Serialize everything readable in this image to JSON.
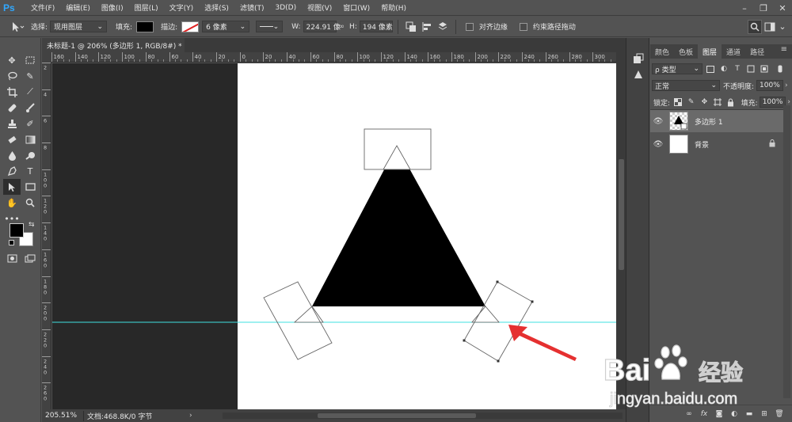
{
  "app": {
    "logo": "Ps"
  },
  "menu": [
    "文件(F)",
    "编辑(E)",
    "图像(I)",
    "图层(L)",
    "文字(Y)",
    "选择(S)",
    "滤镜(T)",
    "3D(D)",
    "视图(V)",
    "窗口(W)",
    "帮助(H)"
  ],
  "options": {
    "select_label": "选择:",
    "select_value": "现用图层",
    "fill_label": "填充:",
    "stroke_label": "描边:",
    "stroke_size": "6 像素",
    "w_label": "W:",
    "w_value": "224.91 像",
    "link_icon": "∞",
    "h_label": "H:",
    "h_value": "194 像素",
    "align_edges_label": "对齐边缘",
    "constrain_path_label": "约束路径拖动"
  },
  "document": {
    "tab_title": "未标题-1 @ 206% (多边形 1, RGB/8#) *",
    "close_glyph": "×"
  },
  "ruler": {
    "top_ticks": [
      "160",
      "140",
      "120",
      "100",
      "80",
      "60",
      "40",
      "20",
      "0",
      "20",
      "40",
      "60",
      "80",
      "100",
      "120",
      "140",
      "160",
      "180",
      "200",
      "220",
      "240",
      "260",
      "280",
      "300"
    ],
    "left_ticks": [
      "2",
      "4",
      "6",
      "8",
      "1 0 0",
      "1 2 0",
      "1 4 0",
      "1 6 0",
      "1 8 0",
      "2 0 0",
      "2 2 0",
      "2 4 0",
      "2 6 0"
    ]
  },
  "status": {
    "zoom": "205.51%",
    "doc_info": "文档:468.8K/0 字节",
    "arrow": "›"
  },
  "layers_panel": {
    "tabs": [
      "颜色",
      "色板",
      "图层",
      "通道",
      "路径"
    ],
    "active_tab": "图层",
    "kind_label": "ρ 类型",
    "blend_mode": "正常",
    "opacity_label": "不透明度:",
    "opacity_value": "100%",
    "lock_label": "锁定:",
    "fill_label": "填充:",
    "fill_value": "100%",
    "layers": [
      {
        "name": "多边形 1",
        "selected": true
      },
      {
        "name": "背景",
        "selected": false,
        "locked": true
      }
    ],
    "footer_icons": [
      "link-icon",
      "fx-icon",
      "mask-icon",
      "adjustment-icon",
      "group-icon",
      "new-layer-icon",
      "delete-icon"
    ]
  },
  "watermark": {
    "brand": "Bai",
    "brand_cn": "经验",
    "url": "jingyan.baidu.com"
  },
  "colors": {
    "guide": "#3fe0e0",
    "arrow": "#e53030",
    "ui_bg": "#535353",
    "canvas_bg": "#282828"
  }
}
